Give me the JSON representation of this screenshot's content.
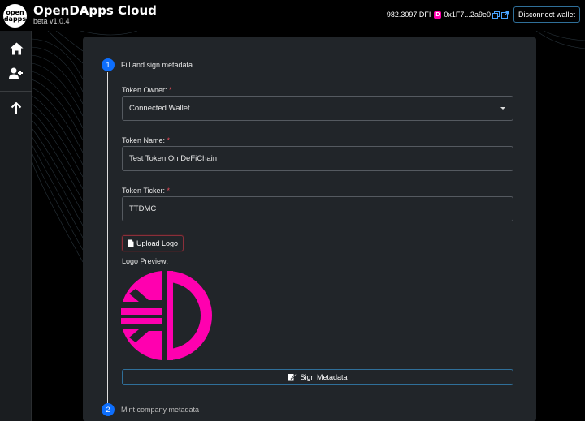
{
  "header": {
    "logo_text": "open dapps",
    "title": "OpenDApps Cloud",
    "version": "beta v1.0.4",
    "balance": "982.3097 DFI",
    "dfi_icon_letter": "D",
    "address": "0x1F7...2a9e0",
    "disconnect_label": "Disconnect wallet"
  },
  "sidebar": {
    "items": [
      {
        "icon": "home-icon"
      },
      {
        "icon": "add-user-icon"
      },
      {
        "icon": "arrow-up-icon"
      }
    ]
  },
  "steps": [
    {
      "number": "1",
      "title": "Fill and sign metadata"
    },
    {
      "number": "2",
      "title": "Mint company metadata"
    }
  ],
  "form": {
    "owner_label": "Token Owner:",
    "owner_value": "Connected Wallet",
    "name_label": "Token Name:",
    "name_value": "Test Token On DeFiChain",
    "ticker_label": "Token Ticker:",
    "ticker_value": "TTDMC",
    "required_mark": "*",
    "upload_label": "Upload Logo",
    "preview_label": "Logo Preview:",
    "sign_label": "Sign Metadata"
  },
  "colors": {
    "accent": "#0d6efd",
    "brand_pink": "#ff00af",
    "panel": "#212529"
  }
}
